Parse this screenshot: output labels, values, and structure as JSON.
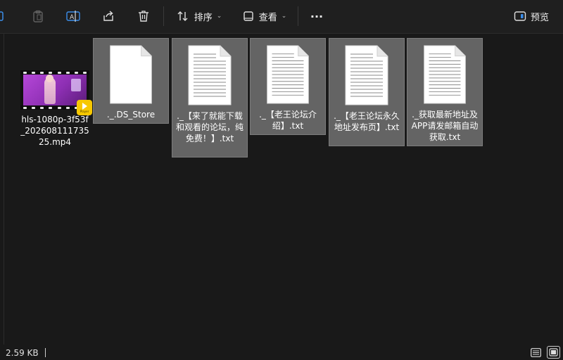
{
  "toolbar": {
    "sort_label": "排序",
    "view_label": "查看",
    "more_label": "···",
    "preview_label": "预览"
  },
  "files": [
    {
      "name": "hls-1080p-3f53f_20260811173525.mp4",
      "type": "video",
      "badge_text": "Player",
      "selected": false
    },
    {
      "name": "._.DS_Store",
      "type": "generic",
      "selected": true
    },
    {
      "name": "._【来了就能下载和观看的论坛，纯免费！】.txt",
      "type": "text",
      "selected": true
    },
    {
      "name": "._【老王论坛介绍】.txt",
      "type": "text",
      "selected": true
    },
    {
      "name": "._【老王论坛永久地址发布页】.txt",
      "type": "text",
      "selected": true
    },
    {
      "name": "._获取最新地址及APP请发邮箱自动获取.txt",
      "type": "text",
      "selected": true
    }
  ],
  "status": {
    "size_text": "2.59 KB"
  },
  "colors": {
    "background": "#191919",
    "selection": "#646464",
    "badge": "#f7c800"
  }
}
